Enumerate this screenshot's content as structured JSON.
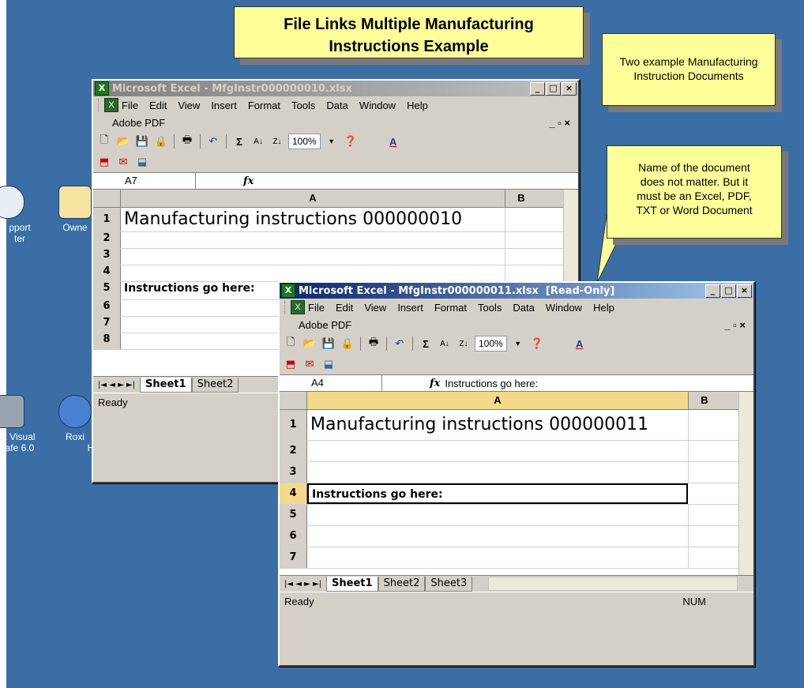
{
  "callouts": {
    "title_line1": "File Links Multiple Manufacturing",
    "title_line2": "Instructions Example",
    "note_two_line1": "Two example Manufacturing",
    "note_two_line2": "Instruction Documents",
    "note_name_line1": "Name of the document",
    "note_name_line2": "does not matter.  But it",
    "note_name_line3": "must be an Excel, PDF,",
    "note_name_line4": "TXT or Word Document"
  },
  "desktop_icons": [
    {
      "label_line1": "pport",
      "label_line2": "ter"
    },
    {
      "label_line1": "Owne",
      "label_line2": ""
    },
    {
      "label_line1": "t Visual",
      "label_line2": "afe 6.0"
    },
    {
      "label_line1": "Roxi",
      "label_line2": "H"
    }
  ],
  "menu": [
    "File",
    "Edit",
    "View",
    "Insert",
    "Format",
    "Tools",
    "Data",
    "Window",
    "Help"
  ],
  "adobe_menu": "Adobe PDF",
  "zoom": "100%",
  "window1": {
    "title": "Microsoft Excel - MfgInstr000000010.xlsx",
    "name_box": "A7",
    "formula": "",
    "col_a": "A",
    "col_b": "B",
    "rows": [
      {
        "num": "1",
        "a": "Manufacturing instructions 000000010"
      },
      {
        "num": "2",
        "a": ""
      },
      {
        "num": "3",
        "a": ""
      },
      {
        "num": "4",
        "a": ""
      },
      {
        "num": "5",
        "a": "Instructions go here:"
      },
      {
        "num": "6",
        "a": ""
      },
      {
        "num": "7",
        "a": ""
      },
      {
        "num": "8",
        "a": ""
      }
    ],
    "tabs": [
      "Sheet1",
      "Sheet2"
    ],
    "status": "Ready"
  },
  "window2": {
    "title": "Microsoft Excel - MfgInstr000000011.xlsx  [Read-Only]",
    "name_box": "A4",
    "formula": "Instructions go here:",
    "col_a": "A",
    "col_b": "B",
    "rows": [
      {
        "num": "1",
        "a": "Manufacturing instructions 000000011"
      },
      {
        "num": "2",
        "a": ""
      },
      {
        "num": "3",
        "a": ""
      },
      {
        "num": "4",
        "a": "Instructions go here:"
      },
      {
        "num": "5",
        "a": ""
      },
      {
        "num": "6",
        "a": ""
      },
      {
        "num": "7",
        "a": ""
      }
    ],
    "tabs": [
      "Sheet1",
      "Sheet2",
      "Sheet3"
    ],
    "status": "Ready",
    "num_indicator": "NUM"
  }
}
